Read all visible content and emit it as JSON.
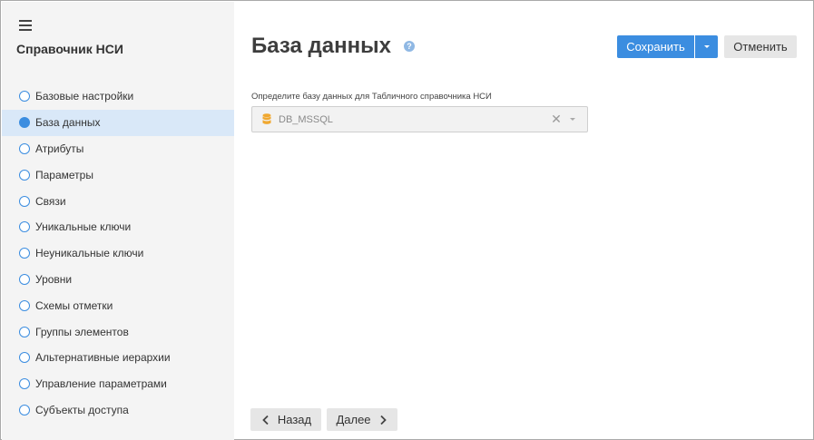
{
  "sidebar": {
    "menu_icon": "hamburger-menu-icon",
    "title": "Справочник НСИ",
    "items": [
      {
        "label": "Базовые настройки",
        "active": false
      },
      {
        "label": "База данных",
        "active": true
      },
      {
        "label": "Атрибуты",
        "active": false
      },
      {
        "label": "Параметры",
        "active": false
      },
      {
        "label": "Связи",
        "active": false
      },
      {
        "label": "Уникальные ключи",
        "active": false
      },
      {
        "label": "Неуникальные ключи",
        "active": false
      },
      {
        "label": "Уровни",
        "active": false
      },
      {
        "label": "Схемы отметки",
        "active": false
      },
      {
        "label": "Группы элементов",
        "active": false
      },
      {
        "label": "Альтернативные иерархии",
        "active": false
      },
      {
        "label": "Управление параметрами",
        "active": false
      },
      {
        "label": "Субъекты доступа",
        "active": false
      }
    ]
  },
  "main": {
    "title": "База данных",
    "help_icon": "?",
    "toolbar": {
      "save_label": "Сохранить",
      "cancel_label": "Отменить"
    },
    "field": {
      "label": "Определите базу данных для Табличного справочника НСИ",
      "value": "DB_MSSQL"
    },
    "footer": {
      "back_label": "Назад",
      "next_label": "Далее"
    }
  },
  "colors": {
    "accent": "#3b8de0",
    "active_item_bg": "#d9e8f8",
    "sidebar_bg": "#f4f4f4",
    "db_icon": "#f0a830"
  }
}
